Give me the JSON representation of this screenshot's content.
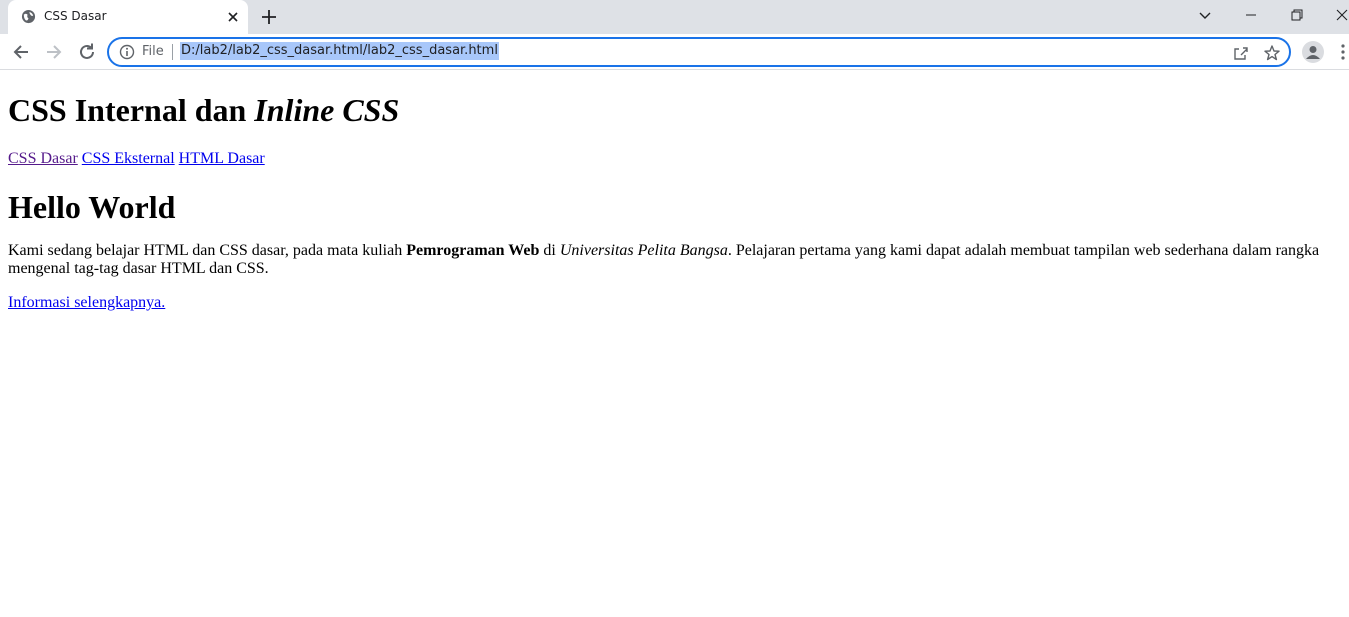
{
  "browser": {
    "tab_title": "CSS Dasar",
    "omnibox_scheme_label": "File",
    "url": "D:/lab2/lab2_css_dasar.html/lab2_css_dasar.html"
  },
  "icons": {
    "favicon": "globe-icon",
    "close": "close-icon",
    "new_tab": "plus-icon",
    "tab_search": "chevron-down-icon",
    "minimize": "minimize-icon",
    "restore": "restore-icon",
    "window_close": "close-icon",
    "back": "back-arrow-icon",
    "forward": "forward-arrow-icon",
    "reload": "reload-icon",
    "info": "info-icon",
    "share": "share-icon",
    "bookmark": "star-icon",
    "profile": "profile-icon",
    "menu": "kebab-menu-icon"
  },
  "colors": {
    "omnibox_border": "#1a73e8",
    "url_highlight": "#a8c7fa",
    "link_visited": "#551a8b",
    "link_unvisited": "#0000ee"
  },
  "page": {
    "heading_main_prefix": "CSS Internal dan ",
    "heading_main_italic": "Inline CSS",
    "nav_links": [
      "CSS Dasar",
      "CSS Eksternal",
      "HTML Dasar"
    ],
    "heading_hello": "Hello World",
    "para_part1": "Kami sedang belajar HTML dan CSS dasar, pada mata kuliah ",
    "para_bold": "Pemrograman Web",
    "para_part2": " di ",
    "para_italic": "Universitas Pelita Bangsa",
    "para_part3": ". Pelajaran pertama yang kami dapat adalah membuat tampilan web sederhana dalam rangka mengenal tag-tag dasar HTML dan CSS.",
    "more_link": "Informasi selengkapnya."
  }
}
